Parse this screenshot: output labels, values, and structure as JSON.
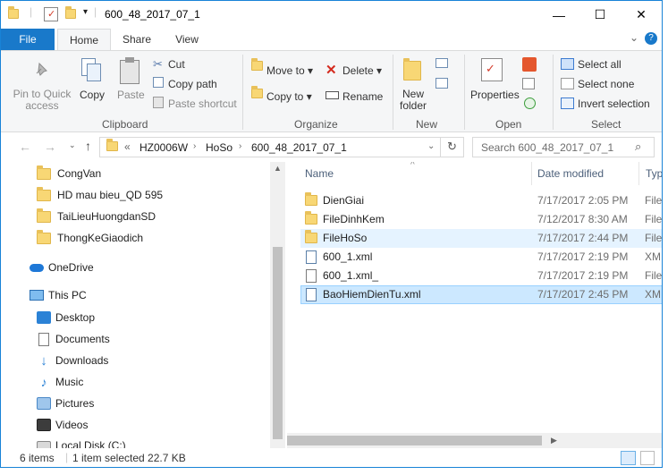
{
  "title": "600_48_2017_07_1",
  "window_buttons": {
    "minimize": "—",
    "maximize": "☐",
    "close": "✕"
  },
  "tabs": {
    "file": "File",
    "home": "Home",
    "share": "Share",
    "view": "View"
  },
  "ribbon_help": {
    "chevron": "⌄",
    "help": "?"
  },
  "ribbon": {
    "clipboard": {
      "pin": "Pin to Quick access",
      "copy": "Copy",
      "paste": "Paste",
      "cut": "Cut",
      "copy_path": "Copy path",
      "paste_shortcut": "Paste shortcut",
      "label": "Clipboard"
    },
    "organize": {
      "move_to": "Move to ▾",
      "copy_to": "Copy to ▾",
      "delete": "Delete ▾",
      "rename": "Rename",
      "label": "Organize"
    },
    "new": {
      "new_folder": "New folder",
      "label": "New"
    },
    "open": {
      "properties": "Properties",
      "label": "Open"
    },
    "select": {
      "select_all": "Select all",
      "select_none": "Select none",
      "invert": "Invert selection",
      "label": "Select"
    }
  },
  "address": {
    "path": [
      "HZ0006W",
      "HoSo",
      "600_48_2017_07_1"
    ],
    "search_placeholder": "Search 600_48_2017_07_1"
  },
  "nav": {
    "folders": [
      "CongVan",
      "HD mau bieu_QD 595",
      "TaiLieuHuongdanSD",
      "ThongKeGiaodich"
    ],
    "onedrive": "OneDrive",
    "thispc": "This PC",
    "pc_items": [
      "Desktop",
      "Documents",
      "Downloads",
      "Music",
      "Pictures",
      "Videos",
      "Local Disk (C:)"
    ]
  },
  "columns": {
    "name": "Name",
    "date": "Date modified",
    "type": "Typ"
  },
  "files": [
    {
      "name": "DienGiai",
      "date": "7/17/2017 2:05 PM",
      "type": "File",
      "icon": "folder"
    },
    {
      "name": "FileDinhKem",
      "date": "7/12/2017 8:30 AM",
      "type": "File",
      "icon": "folder"
    },
    {
      "name": "FileHoSo",
      "date": "7/17/2017 2:44 PM",
      "type": "File",
      "icon": "folder"
    },
    {
      "name": "600_1.xml",
      "date": "7/17/2017 2:19 PM",
      "type": "XM",
      "icon": "xml"
    },
    {
      "name": "600_1.xml_",
      "date": "7/17/2017 2:19 PM",
      "type": "File",
      "icon": "doc"
    },
    {
      "name": "BaoHiemDienTu.xml",
      "date": "7/17/2017 2:45 PM",
      "type": "XM",
      "icon": "xml"
    }
  ],
  "status": {
    "count": "6 items",
    "selected": "1 item selected  22.7 KB"
  }
}
